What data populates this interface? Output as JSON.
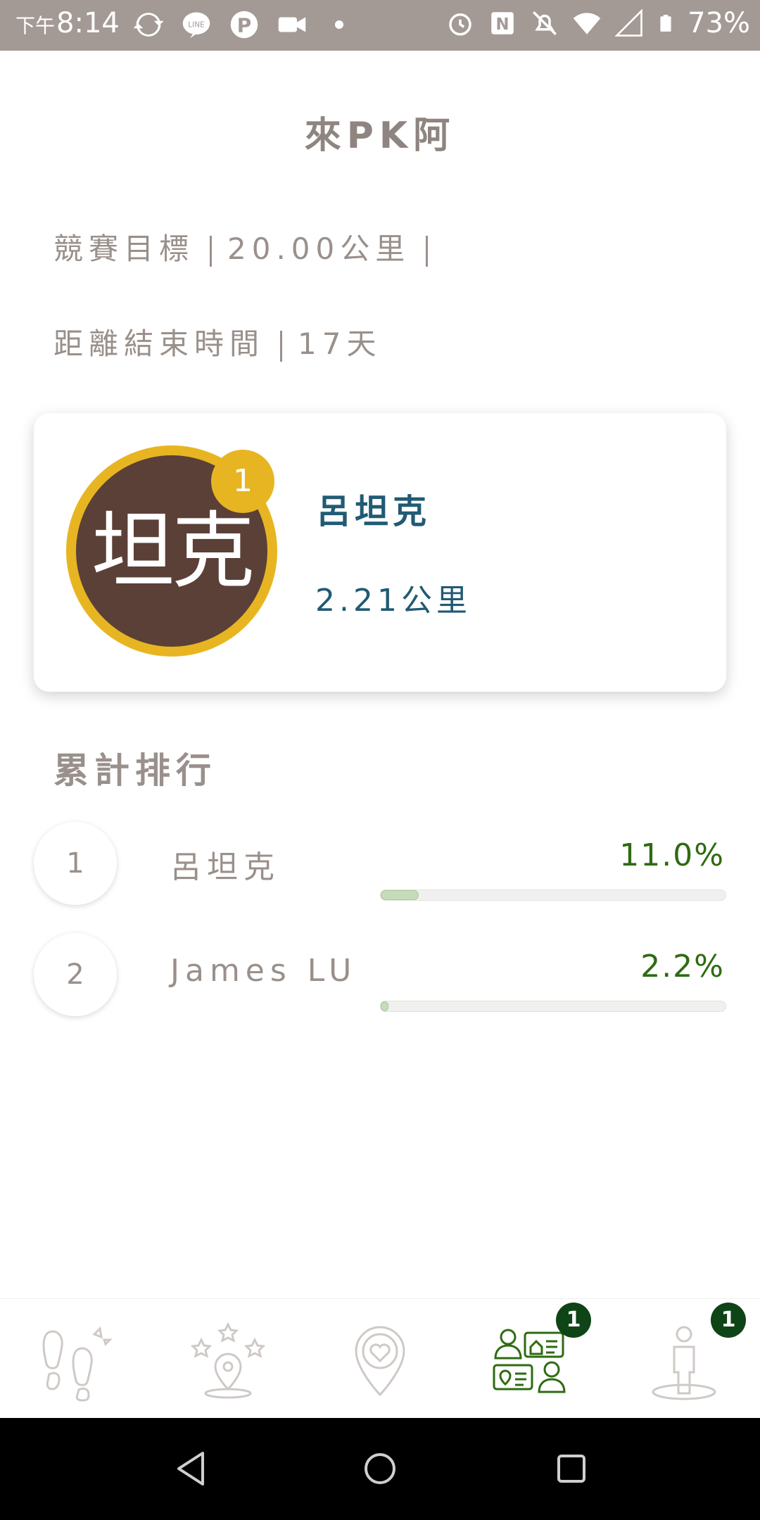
{
  "status_bar": {
    "time_prefix": "下午",
    "time": "8:14",
    "battery": "73%"
  },
  "header": {
    "title": "來PK阿"
  },
  "competition": {
    "goal_label": "競賽目標",
    "goal_value": "20.00公里",
    "remaining_label": "距離結束時間",
    "remaining_value": "17天"
  },
  "leader": {
    "avatar_text": "坦克",
    "rank": "1",
    "name": "呂坦克",
    "distance": "2.21公里"
  },
  "ranking": {
    "title": "累計排行",
    "rows": [
      {
        "rank": "1",
        "name": "呂坦克",
        "percent": "11.0%",
        "progress": 0.11
      },
      {
        "rank": "2",
        "name": "James LU",
        "percent": "2.2%",
        "progress": 0.022
      }
    ]
  },
  "bottom_nav": {
    "items": [
      {
        "icon": "footsteps-icon"
      },
      {
        "icon": "star-location-icon"
      },
      {
        "icon": "heart-location-icon"
      },
      {
        "icon": "contacts-exchange-icon",
        "badge": "1",
        "active": true
      },
      {
        "icon": "person-standing-icon",
        "badge": "1"
      }
    ],
    "active_color": "#2e6b12",
    "inactive_color": "#cfc9c6"
  }
}
